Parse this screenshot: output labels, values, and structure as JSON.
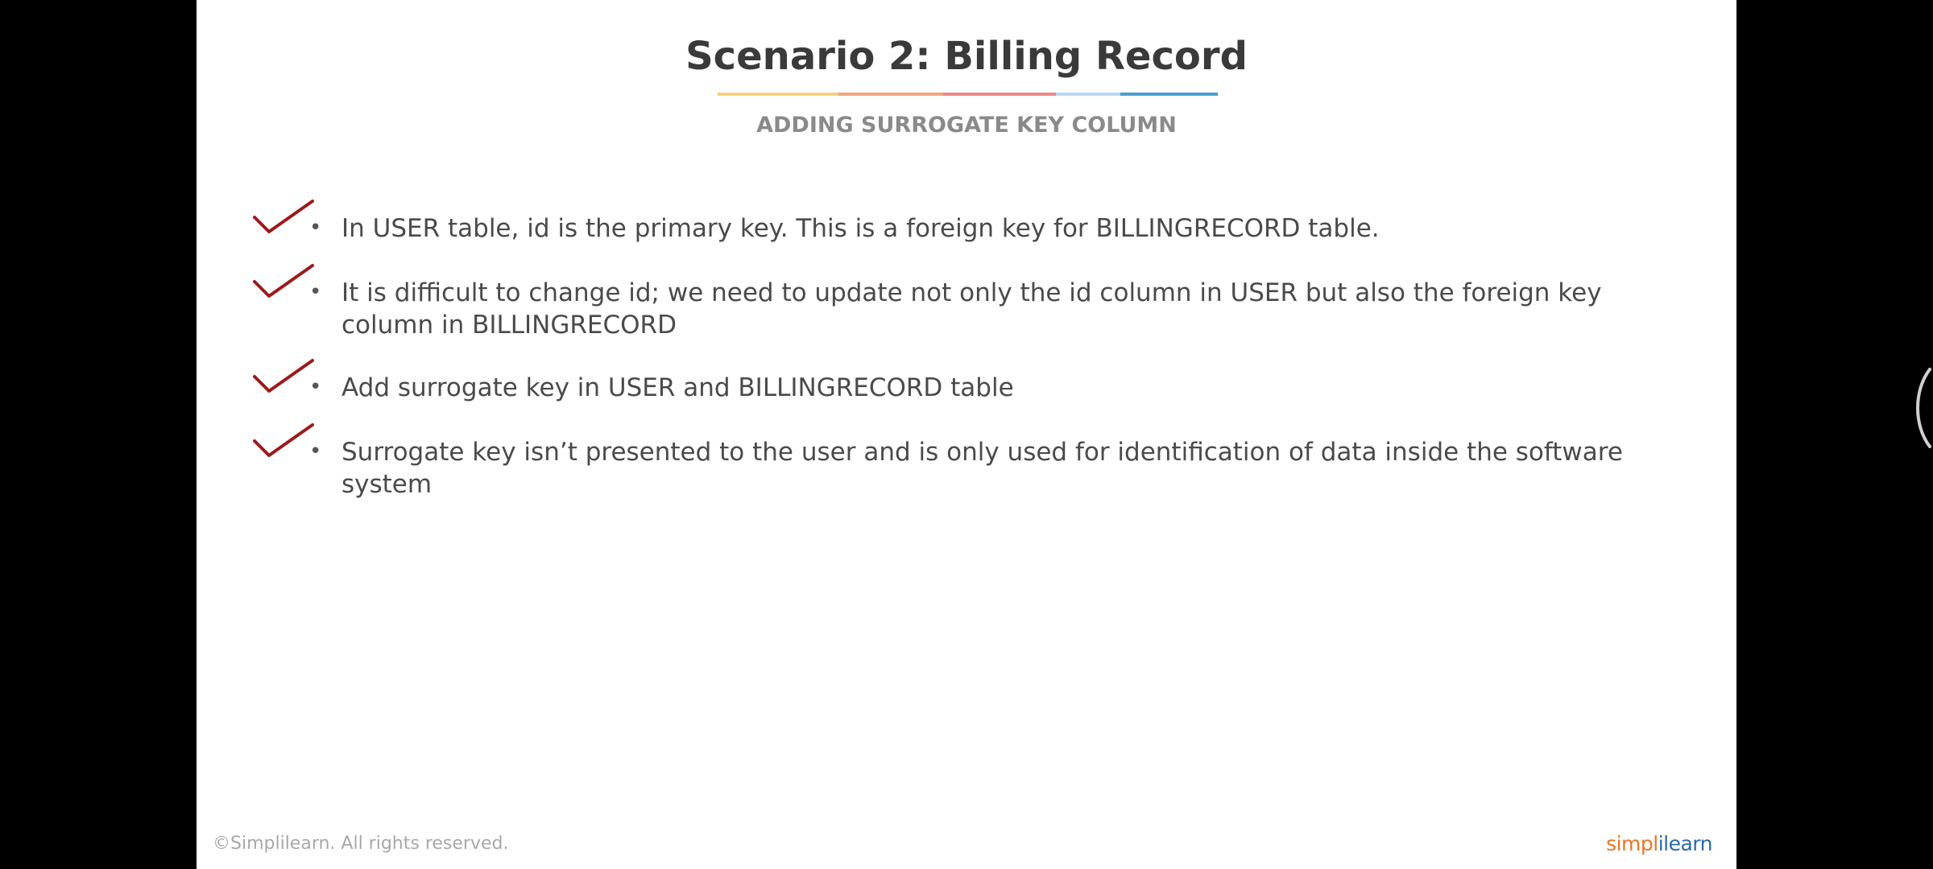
{
  "slide": {
    "title": "Scenario 2: Billing Record",
    "subtitle": "ADDING SURROGATE KEY COLUMN",
    "title_rule_colors": [
      "#f6cf7f",
      "#f0a77f",
      "#ea8a8a",
      "#b9d9ef",
      "#4a9fd0"
    ],
    "check_color": "#9b1b1b",
    "bullet_marker": "•",
    "bullets": [
      {
        "text": "In USER table, id is the primary key. This is a foreign key for BILLINGRECORD table."
      },
      {
        "text": "It is difficult to change id; we need to update not only the id column in USER but also the foreign key column in BILLINGRECORD"
      },
      {
        "text": "Add surrogate key in USER and BILLINGRECORD table"
      },
      {
        "text": "Surrogate key isn’t presented to the user and is only used for identification of data inside the software system"
      }
    ],
    "footer": {
      "copyright": "©Simplilearn. All rights reserved.",
      "brand_part1": "simpl",
      "brand_part2": "ilearn"
    }
  },
  "overlay": {
    "side_handle_icon": "side-handle-icon"
  }
}
